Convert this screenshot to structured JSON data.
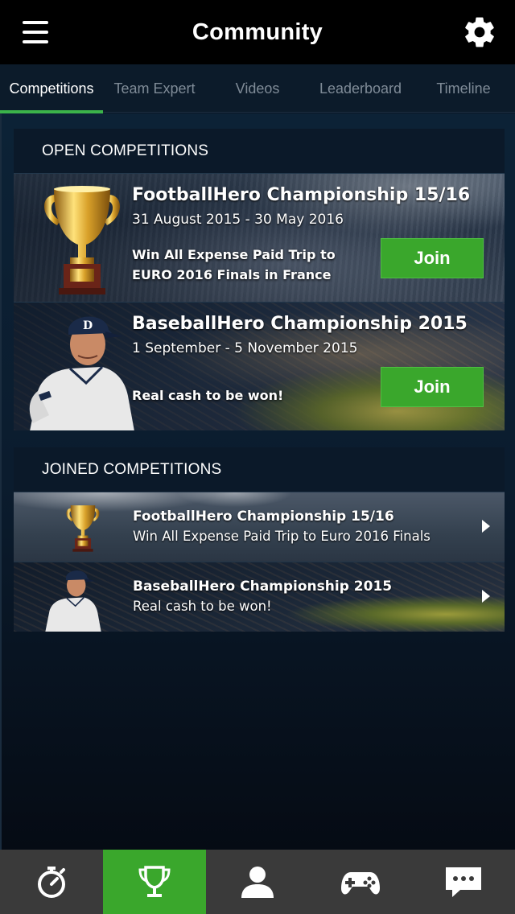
{
  "header": {
    "title": "Community",
    "menu_icon": "hamburger-menu-icon",
    "settings_icon": "gear-icon"
  },
  "tabs": [
    {
      "label": "Competitions",
      "active": true
    },
    {
      "label": "Team Expert",
      "active": false
    },
    {
      "label": "Videos",
      "active": false
    },
    {
      "label": "Leaderboard",
      "active": false
    },
    {
      "label": "Timeline",
      "active": false
    }
  ],
  "open_competitions": {
    "heading": "OPEN COMPETITIONS",
    "items": [
      {
        "title": "FootballHero Championship 15/16",
        "dates": "31 August 2015 - 30 May 2016",
        "prize": "Win All Expense Paid Trip to EURO 2016 Finals in France",
        "button": "Join",
        "image": "trophy-icon"
      },
      {
        "title": "BaseballHero Championship 2015",
        "dates": "1 September - 5 November 2015",
        "prize": "Real cash to be won!",
        "button": "Join",
        "image": "baseball-player-image"
      }
    ]
  },
  "joined_competitions": {
    "heading": "JOINED COMPETITIONS",
    "items": [
      {
        "title": "FootballHero Championship 15/16",
        "subtitle": "Win All Expense Paid Trip to Euro 2016 Finals",
        "image": "trophy-icon"
      },
      {
        "title": "BaseballHero Championship 2015",
        "subtitle": "Real cash to be won!",
        "image": "baseball-player-image"
      }
    ]
  },
  "bottom_nav": [
    {
      "icon": "stopwatch-icon",
      "active": false
    },
    {
      "icon": "trophy-icon",
      "active": true
    },
    {
      "icon": "person-icon",
      "active": false
    },
    {
      "icon": "gamepad-icon",
      "active": false
    },
    {
      "icon": "chat-bubble-icon",
      "active": false
    }
  ],
  "colors": {
    "accent_green": "#3aa72c",
    "header_bg": "#000000",
    "tab_inactive": "#7f8b97",
    "bottom_nav_bg": "#3a3a3a"
  }
}
